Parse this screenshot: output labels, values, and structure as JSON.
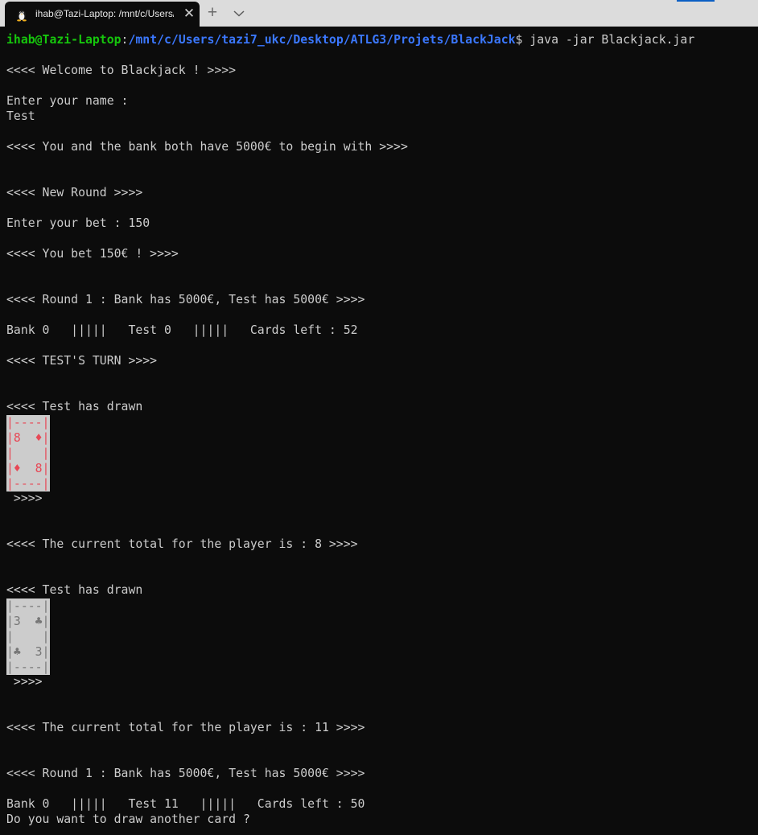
{
  "tab": {
    "title": "ihab@Tazi-Laptop: /mnt/c/Users/tazi7_ukc/Desktop/ATLG3/Projets/BlackJack",
    "close_glyph": "✕",
    "new_tab_glyph": "+",
    "icon": "tux-linux-icon"
  },
  "prompt": {
    "user": "ihab@Tazi-Laptop",
    "sep": ":",
    "path": "/mnt/c/Users/tazi7_ukc/Desktop/ATLG3/Projets/BlackJack",
    "suffix": "$ java -jar Blackjack.jar"
  },
  "lines": {
    "welcome": "<<<< Welcome to Blackjack ! >>>>",
    "enter_name": "Enter your name :",
    "name_input": "Test",
    "both_have": "<<<< You and the bank both have 5000€ to begin with >>>>",
    "new_round": "<<<< New Round >>>>",
    "enter_bet": "Enter your bet : 150",
    "you_bet": "<<<< You bet 150€ ! >>>>",
    "round_status_1": "<<<< Round 1 : Bank has 5000€, Test has 5000€ >>>>",
    "score_1": "Bank 0   |||||   Test 0   |||||   Cards left : 52",
    "turn": "<<<< TEST'S TURN >>>>",
    "drawn_1": "<<<< Test has drawn",
    "close_1": " >>>>",
    "total_1": "<<<< The current total for the player is : 8 >>>>",
    "drawn_2": "<<<< Test has drawn",
    "close_2": " >>>>",
    "total_2": "<<<< The current total for the player is : 11 >>>>",
    "round_status_2": "<<<< Round 1 : Bank has 5000€, Test has 5000€ >>>>",
    "score_2": "Bank 0   |||||   Test 11   |||||   Cards left : 50",
    "ask_draw": "Do you want to draw another card ?"
  },
  "cards": [
    {
      "rank": "8",
      "suit": "diamond",
      "color": "#e74856",
      "rows": [
        "|----|",
        "|8  ♦|",
        "|    |",
        "|♦  8|",
        "|----|"
      ]
    },
    {
      "rank": "3",
      "suit": "club",
      "color": "#767676",
      "rows": [
        "|----|",
        "|3  ♣|",
        "|    |",
        "|♣  3|",
        "|----|"
      ]
    }
  ]
}
